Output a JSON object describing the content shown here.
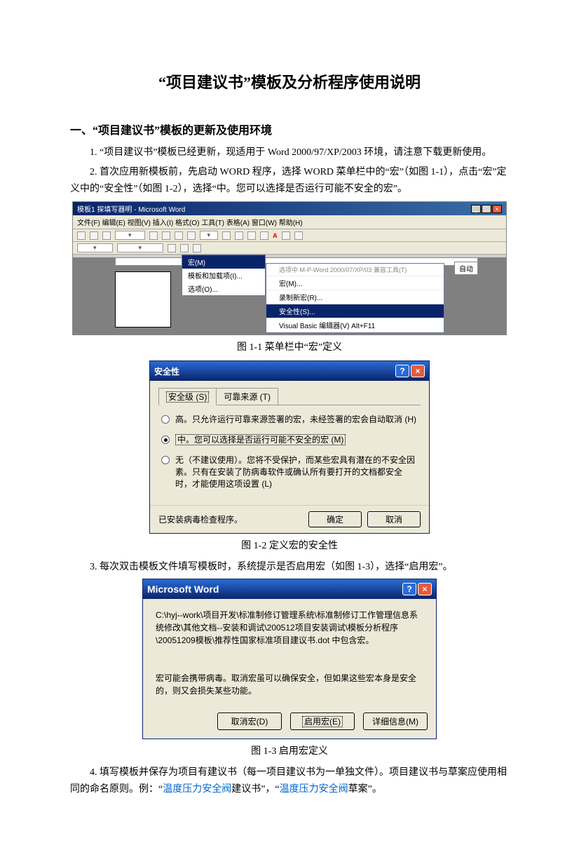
{
  "title": "“项目建议书”模板及分析程序使用说明",
  "section1_head": "一、“项目建议书”模板的更新及使用环境",
  "para1": "1. “项目建议书”模板已经更新，现适用于 Word 2000/97/XP/2003 环境，请注意下载更新使用。",
  "para2": "2. 首次应用新模板前，先启动 WORD 程序，选择 WORD 菜单栏中的“宏”（如图 1-1），点击“宏”定义中的“安全性”（如图 1-2），选择“中。您可以选择是否运行可能不安全的宏”。",
  "fig11": {
    "title": "模板1 探填写器明 - Microsoft Word",
    "menubar": "文件(F)  编辑(E)  视图(V)  插入(I)  格式(O)  工具(T)  表格(A)  窗口(W)  帮助(H)",
    "toolbar_A": "A",
    "dropdown": {
      "i0": "宏(M)",
      "i1": "模板和加载项(I)...",
      "i2": "选项(O)..."
    },
    "submenu": {
      "i0": "选项中 M-P-Word 2000/07/XP/03 兼容工具(T)",
      "i1": "宏(M)...",
      "i2": "录制新宏(R)...",
      "i3": "安全性(S)...",
      "i4": "Visual Basic 编辑器(V)       Alt+F11"
    },
    "autoopt": "自动",
    "caption": "图 1-1 菜单栏中“宏”定义"
  },
  "fig12": {
    "title": "安全性",
    "tab1": "安全级 (S)",
    "tab2": "可靠来源 (T)",
    "opt_high": "高。只允许运行可靠来源签署的宏，未经签署的宏会自动取消 (H)",
    "opt_mid": "中。您可以选择是否运行可能不安全的宏 (M)",
    "opt_low": "无（不建议使用）。您将不受保护，而某些宏具有潜在的不安全因素。只有在安装了防病毒软件或确认所有要打开的文档都安全时，才能使用这项设置 (L)",
    "note": "已安装病毒检查程序。",
    "ok": "确定",
    "cancel": "取消",
    "caption": "图 1-2 定义宏的安全性"
  },
  "para3": "3. 每次双击模板文件填写模板时，系统提示是否启用宏（如图 1-3），选择“启用宏”。",
  "fig13": {
    "title": "Microsoft Word",
    "msg1": "C:\\hyj--work\\项目开发\\标准制修订管理系统\\标准制修订工作管理信息系统修改\\其他文档--安装和调试\\200512项目安装调试\\模板分析程序\\20051209模板\\推荐性国家标准项目建议书.dot 中包含宏。",
    "msg2": "宏可能会携带病毒。取消宏虽可以确保安全，但如果这些宏本身是安全的，则又会损失某些功能。",
    "disable": "取消宏(D)",
    "enable": "启用宏(E)",
    "details": "详细信息(M)",
    "caption": "图 1-3 启用宏定义"
  },
  "para4a": "4. 填写模板并保存为项目有建议书（每一项目建议书为一单独文件）。项目建议书与草案应使用相同的命名原则。例：“",
  "para4_link1": "温度压力安全阀",
  "para4b": "建议书”，“",
  "para4_link2": "温度压力安全阀",
  "para4c": "草案”。"
}
